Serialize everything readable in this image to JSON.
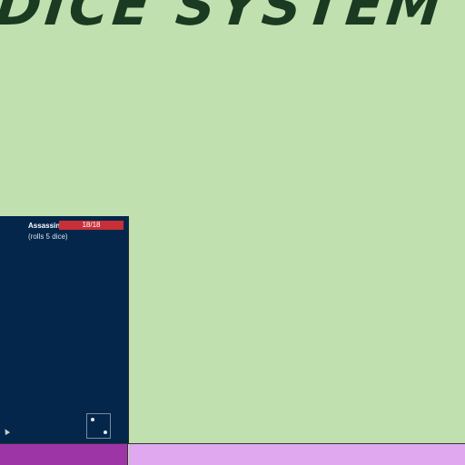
{
  "header": {
    "title": "DICE SYSTEM"
  },
  "enemy_panel": {
    "name": "Assassin",
    "hp_text": "18/18",
    "hp_fraction": 1.0,
    "subtitle": "(rolls 5 dice)",
    "hp_color": "#c92f36",
    "panel_color": "#03264a"
  },
  "die": {
    "face_value": 2
  },
  "bottom_tabs": {
    "left_color": "#9d35a7",
    "right_color": "#e0a8ee"
  },
  "colors": {
    "background": "#c0e0b0",
    "title": "#1a3a22"
  }
}
